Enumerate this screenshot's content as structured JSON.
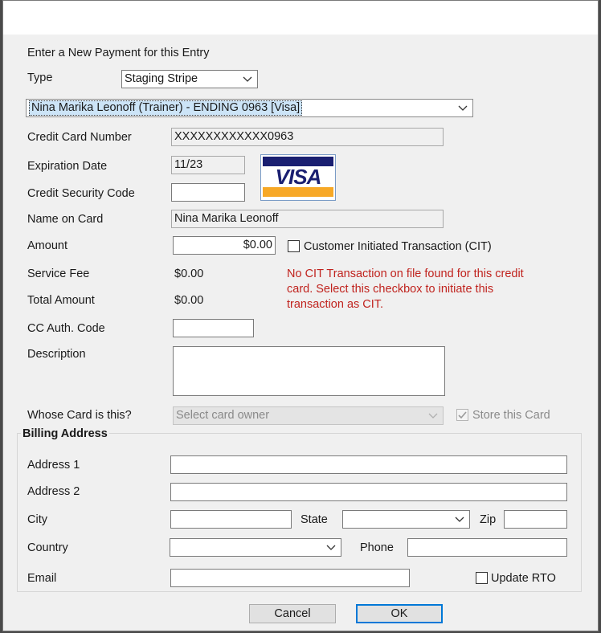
{
  "form": {
    "heading": "Enter a New Payment for this Entry",
    "type_label": "Type",
    "type_value": "Staging Stripe",
    "card_select_value": "Nina Marika Leonoff (Trainer) - ENDING 0963 [Visa]",
    "cc_number_label": "Credit Card Number",
    "cc_number_value": "XXXXXXXXXXXX0963",
    "exp_label": "Expiration Date",
    "exp_value": "11/23",
    "csc_label": "Credit Security Code",
    "csc_value": "",
    "name_label": "Name on Card",
    "name_value": "Nina Marika Leonoff",
    "amount_label": "Amount",
    "amount_value": "$0.00",
    "cit_label": "Customer Initiated Transaction (CIT)",
    "service_fee_label": "Service Fee",
    "service_fee_value": "$0.00",
    "total_label": "Total Amount",
    "total_value": "$0.00",
    "cit_warning_line1": "No CIT Transaction on file found for this credit",
    "cit_warning_line2": "card. Select this checkbox to initiate this",
    "cit_warning_line3": "transaction as CIT.",
    "auth_label": "CC Auth. Code",
    "auth_value": "",
    "description_label": "Description",
    "description_value": "",
    "owner_label": "Whose Card is this?",
    "owner_placeholder": "Select card owner",
    "store_card_label": "Store this Card",
    "store_card_checked": true,
    "card_brand": "VISA"
  },
  "billing": {
    "title": "Billing Address",
    "address1_label": "Address 1",
    "address2_label": "Address 2",
    "city_label": "City",
    "state_label": "State",
    "zip_label": "Zip",
    "country_label": "Country",
    "phone_label": "Phone",
    "email_label": "Email",
    "update_rto_label": "Update RTO"
  },
  "buttons": {
    "cancel": "Cancel",
    "ok": "OK"
  },
  "colors": {
    "warning": "#c0231e",
    "visa_blue": "#1a1f71",
    "visa_gold": "#f7b600",
    "default_button_border": "#0078d7"
  }
}
